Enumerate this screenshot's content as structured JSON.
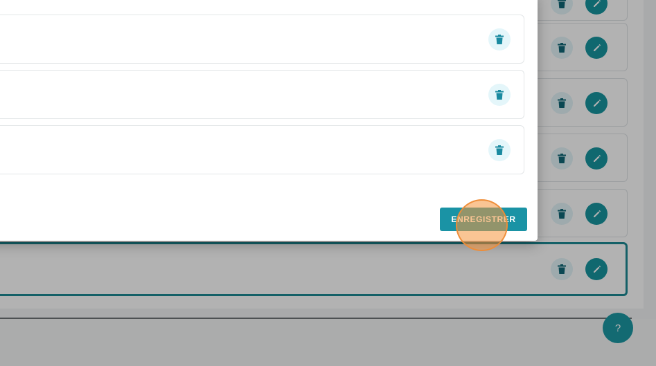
{
  "background": {
    "list": {
      "rows": [
        {
          "id": "row-1"
        },
        {
          "id": "row-2"
        },
        {
          "id": "row-3"
        },
        {
          "id": "row-4"
        },
        {
          "id": "row-5",
          "selected": true
        }
      ]
    },
    "help_label": "?"
  },
  "modal": {
    "rows": [
      {
        "id": "modal-row-1"
      },
      {
        "id": "modal-row-2"
      },
      {
        "id": "modal-row-3"
      }
    ],
    "save_label": "ENREGISTRER"
  },
  "colors": {
    "accent": "#1a93a5",
    "delete_icon": "#1a8aa0",
    "delete_bg": "#e4f6fa",
    "click_marker": "#f5963c"
  },
  "icons": {
    "delete": "trash-icon",
    "edit": "pencil-icon",
    "help": "question-icon"
  }
}
